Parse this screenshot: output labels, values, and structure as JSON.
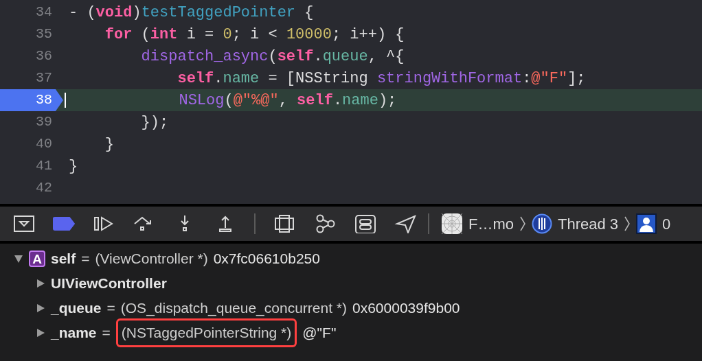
{
  "editor": {
    "lines": [
      {
        "number": "34",
        "current": false,
        "tokens": [
          {
            "kind": "plain",
            "text": "- ("
          },
          {
            "kind": "keyword",
            "text": "void"
          },
          {
            "kind": "plain",
            "text": ")"
          },
          {
            "kind": "declaration",
            "text": "testTaggedPointer"
          },
          {
            "kind": "plain",
            "text": " {"
          }
        ]
      },
      {
        "number": "35",
        "current": false,
        "tokens": [
          {
            "kind": "keyword",
            "text": "    for"
          },
          {
            "kind": "plain",
            "text": " ("
          },
          {
            "kind": "keyword",
            "text": "int"
          },
          {
            "kind": "plain",
            "text": " i = "
          },
          {
            "kind": "number",
            "text": "0"
          },
          {
            "kind": "plain",
            "text": "; i < "
          },
          {
            "kind": "number",
            "text": "10000"
          },
          {
            "kind": "plain",
            "text": "; i++) {"
          }
        ]
      },
      {
        "number": "36",
        "current": false,
        "tokens": [
          {
            "kind": "function",
            "text": "        dispatch_async"
          },
          {
            "kind": "plain",
            "text": "("
          },
          {
            "kind": "keyword",
            "text": "self"
          },
          {
            "kind": "plain",
            "text": "."
          },
          {
            "kind": "property",
            "text": "queue"
          },
          {
            "kind": "plain",
            "text": ", ^{"
          }
        ]
      },
      {
        "number": "37",
        "current": false,
        "tokens": [
          {
            "kind": "keyword",
            "text": "            self"
          },
          {
            "kind": "plain",
            "text": "."
          },
          {
            "kind": "property",
            "text": "name"
          },
          {
            "kind": "plain",
            "text": " = [NSString "
          },
          {
            "kind": "function",
            "text": "stringWithFormat"
          },
          {
            "kind": "plain",
            "text": ":"
          },
          {
            "kind": "string",
            "text": "@\"F\""
          },
          {
            "kind": "plain",
            "text": "];"
          }
        ]
      },
      {
        "number": "38",
        "current": true,
        "tokens": [
          {
            "kind": "function",
            "text": "            NSLog"
          },
          {
            "kind": "plain",
            "text": "("
          },
          {
            "kind": "string",
            "text": "@\"%@\""
          },
          {
            "kind": "plain",
            "text": ", "
          },
          {
            "kind": "keyword",
            "text": "self"
          },
          {
            "kind": "plain",
            "text": "."
          },
          {
            "kind": "property",
            "text": "name"
          },
          {
            "kind": "plain",
            "text": ");"
          }
        ]
      },
      {
        "number": "39",
        "current": false,
        "tokens": [
          {
            "kind": "plain",
            "text": "        });"
          }
        ]
      },
      {
        "number": "40",
        "current": false,
        "tokens": [
          {
            "kind": "plain",
            "text": "    }"
          }
        ]
      },
      {
        "number": "41",
        "current": false,
        "tokens": [
          {
            "kind": "plain",
            "text": "}"
          }
        ]
      },
      {
        "number": "42",
        "current": false
      }
    ]
  },
  "debug_bar": {
    "breakpoints_active": true,
    "breadcrumbs": [
      {
        "kind": "app",
        "label": "F…mo"
      },
      {
        "kind": "thread",
        "label": "Thread 3"
      },
      {
        "kind": "frame",
        "label": "0"
      }
    ]
  },
  "variables": [
    {
      "name": "self",
      "badge": "A",
      "separator": "=",
      "type": "(ViewController *)",
      "value": "0x7fc06610b250",
      "expanded": true,
      "children": [
        {
          "name": "UIViewController",
          "expanded": false
        },
        {
          "name": "_queue",
          "separator": "=",
          "type": "(OS_dispatch_queue_concurrent *)",
          "value": "0x6000039f9b00",
          "expanded": false
        },
        {
          "name": "_name",
          "separator": "=",
          "type": "(NSTaggedPointerString *)",
          "value": "@\"F\"",
          "expanded": false,
          "highlighted": true
        }
      ]
    }
  ]
}
